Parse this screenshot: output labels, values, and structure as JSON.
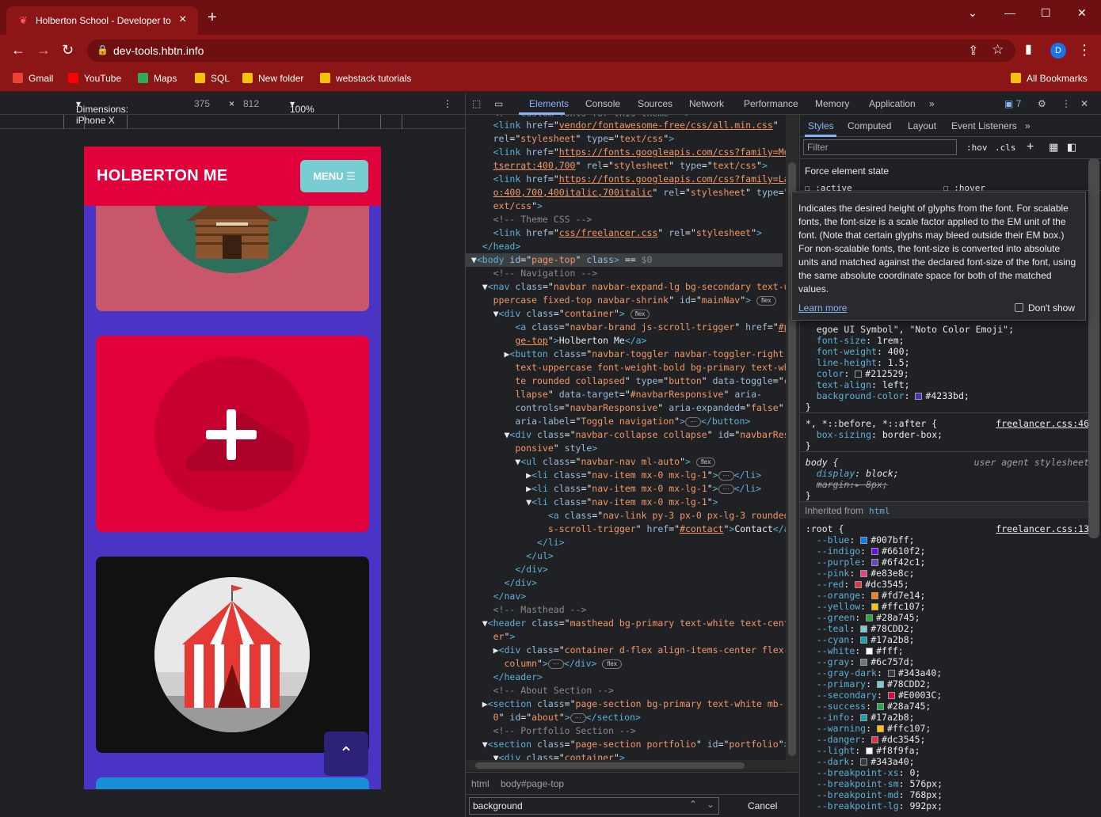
{
  "browser": {
    "tab_title": "Holberton School - Developer to",
    "url": "dev-tools.hbtn.info",
    "avatar_letter": "D",
    "bookmarks": [
      {
        "label": "Gmail",
        "color": "#ea4335"
      },
      {
        "label": "YouTube",
        "color": "#ff0000"
      },
      {
        "label": "Maps",
        "color": "#34a853"
      },
      {
        "label": "SQL",
        "color": "#f4c20d"
      },
      {
        "label": "New folder",
        "color": "#f4c20d"
      },
      {
        "label": "webstack tutorials",
        "color": "#f4c20d"
      }
    ],
    "all_bookmarks": "All Bookmarks"
  },
  "device_toolbar": {
    "dimensions": "Dimensions: iPhone X",
    "width": "375",
    "times": "×",
    "height": "812",
    "zoom": "100%"
  },
  "site": {
    "brand": "HOLBERTON ME",
    "menu_label": "MENU",
    "colors": {
      "primary": "#e0003c",
      "secondary": "#4a34c6",
      "menu": "#78cdd2"
    }
  },
  "devtools": {
    "tabs": [
      "Elements",
      "Console",
      "Sources",
      "Network",
      "Performance",
      "Memory",
      "Application"
    ],
    "issues_count": "7",
    "styles_tabs": [
      "Styles",
      "Computed",
      "Layout",
      "Event Listeners"
    ],
    "filter_placeholder": "Filter",
    "hov": ":hov",
    "cls": ".cls",
    "force_state": "Force element state",
    "force_active": ":active",
    "force_hover": ":hover",
    "tooltip": {
      "text": "Indicates the desired height of glyphs from the font. For scalable fonts, the font-size is a scale factor applied to the EM unit of the font. (Note that certain glyphs may bleed outside their EM box.) For non-scalable fonts, the font-size is converted into absolute units and matched against the declared font-size of the font, using the same absolute coordinate space for both of the matched values.",
      "learn_more": "Learn more",
      "dont_show": "Don't show"
    },
    "breadcrumbs": [
      "html",
      "body#page-top"
    ],
    "search_value": "background",
    "cancel": "Cancel",
    "inherited_from": "Inherited from",
    "inherited_tag": "html",
    "user_agent": "user agent stylesheet",
    "sources": [
      "freelancer.css:46",
      "freelancer.css:13"
    ]
  }
}
